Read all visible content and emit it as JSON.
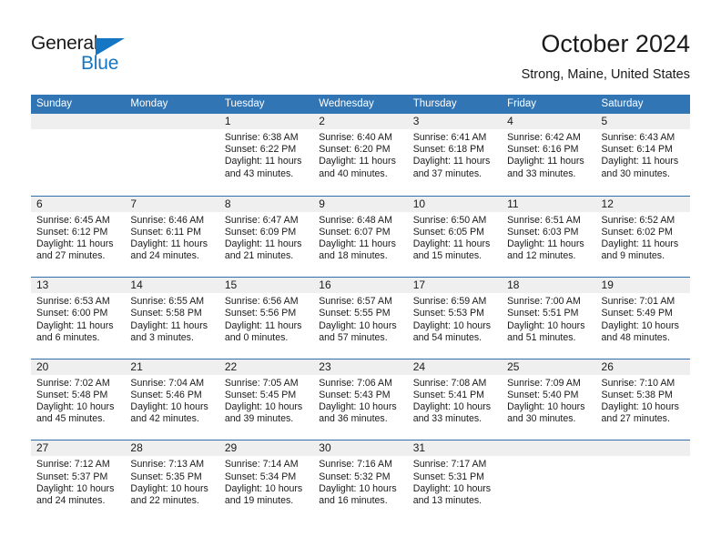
{
  "brand": {
    "name_part1": "General",
    "name_part2": "Blue"
  },
  "header": {
    "title": "October 2024",
    "subtitle": "Strong, Maine, United States"
  },
  "colors": {
    "header_blue": "#3175b5",
    "separator_blue": "#2f6fae",
    "daynum_band": "#efefef",
    "brand_blue": "#1577c4"
  },
  "weekdays": [
    "Sunday",
    "Monday",
    "Tuesday",
    "Wednesday",
    "Thursday",
    "Friday",
    "Saturday"
  ],
  "weeks": [
    [
      {
        "day": "",
        "sunrise": "",
        "sunset": "",
        "daylight": "",
        "empty": true
      },
      {
        "day": "",
        "sunrise": "",
        "sunset": "",
        "daylight": "",
        "empty": true
      },
      {
        "day": "1",
        "sunrise": "Sunrise: 6:38 AM",
        "sunset": "Sunset: 6:22 PM",
        "daylight": "Daylight: 11 hours and 43 minutes."
      },
      {
        "day": "2",
        "sunrise": "Sunrise: 6:40 AM",
        "sunset": "Sunset: 6:20 PM",
        "daylight": "Daylight: 11 hours and 40 minutes."
      },
      {
        "day": "3",
        "sunrise": "Sunrise: 6:41 AM",
        "sunset": "Sunset: 6:18 PM",
        "daylight": "Daylight: 11 hours and 37 minutes."
      },
      {
        "day": "4",
        "sunrise": "Sunrise: 6:42 AM",
        "sunset": "Sunset: 6:16 PM",
        "daylight": "Daylight: 11 hours and 33 minutes."
      },
      {
        "day": "5",
        "sunrise": "Sunrise: 6:43 AM",
        "sunset": "Sunset: 6:14 PM",
        "daylight": "Daylight: 11 hours and 30 minutes."
      }
    ],
    [
      {
        "day": "6",
        "sunrise": "Sunrise: 6:45 AM",
        "sunset": "Sunset: 6:12 PM",
        "daylight": "Daylight: 11 hours and 27 minutes."
      },
      {
        "day": "7",
        "sunrise": "Sunrise: 6:46 AM",
        "sunset": "Sunset: 6:11 PM",
        "daylight": "Daylight: 11 hours and 24 minutes."
      },
      {
        "day": "8",
        "sunrise": "Sunrise: 6:47 AM",
        "sunset": "Sunset: 6:09 PM",
        "daylight": "Daylight: 11 hours and 21 minutes."
      },
      {
        "day": "9",
        "sunrise": "Sunrise: 6:48 AM",
        "sunset": "Sunset: 6:07 PM",
        "daylight": "Daylight: 11 hours and 18 minutes."
      },
      {
        "day": "10",
        "sunrise": "Sunrise: 6:50 AM",
        "sunset": "Sunset: 6:05 PM",
        "daylight": "Daylight: 11 hours and 15 minutes."
      },
      {
        "day": "11",
        "sunrise": "Sunrise: 6:51 AM",
        "sunset": "Sunset: 6:03 PM",
        "daylight": "Daylight: 11 hours and 12 minutes."
      },
      {
        "day": "12",
        "sunrise": "Sunrise: 6:52 AM",
        "sunset": "Sunset: 6:02 PM",
        "daylight": "Daylight: 11 hours and 9 minutes."
      }
    ],
    [
      {
        "day": "13",
        "sunrise": "Sunrise: 6:53 AM",
        "sunset": "Sunset: 6:00 PM",
        "daylight": "Daylight: 11 hours and 6 minutes."
      },
      {
        "day": "14",
        "sunrise": "Sunrise: 6:55 AM",
        "sunset": "Sunset: 5:58 PM",
        "daylight": "Daylight: 11 hours and 3 minutes."
      },
      {
        "day": "15",
        "sunrise": "Sunrise: 6:56 AM",
        "sunset": "Sunset: 5:56 PM",
        "daylight": "Daylight: 11 hours and 0 minutes."
      },
      {
        "day": "16",
        "sunrise": "Sunrise: 6:57 AM",
        "sunset": "Sunset: 5:55 PM",
        "daylight": "Daylight: 10 hours and 57 minutes."
      },
      {
        "day": "17",
        "sunrise": "Sunrise: 6:59 AM",
        "sunset": "Sunset: 5:53 PM",
        "daylight": "Daylight: 10 hours and 54 minutes."
      },
      {
        "day": "18",
        "sunrise": "Sunrise: 7:00 AM",
        "sunset": "Sunset: 5:51 PM",
        "daylight": "Daylight: 10 hours and 51 minutes."
      },
      {
        "day": "19",
        "sunrise": "Sunrise: 7:01 AM",
        "sunset": "Sunset: 5:49 PM",
        "daylight": "Daylight: 10 hours and 48 minutes."
      }
    ],
    [
      {
        "day": "20",
        "sunrise": "Sunrise: 7:02 AM",
        "sunset": "Sunset: 5:48 PM",
        "daylight": "Daylight: 10 hours and 45 minutes."
      },
      {
        "day": "21",
        "sunrise": "Sunrise: 7:04 AM",
        "sunset": "Sunset: 5:46 PM",
        "daylight": "Daylight: 10 hours and 42 minutes."
      },
      {
        "day": "22",
        "sunrise": "Sunrise: 7:05 AM",
        "sunset": "Sunset: 5:45 PM",
        "daylight": "Daylight: 10 hours and 39 minutes."
      },
      {
        "day": "23",
        "sunrise": "Sunrise: 7:06 AM",
        "sunset": "Sunset: 5:43 PM",
        "daylight": "Daylight: 10 hours and 36 minutes."
      },
      {
        "day": "24",
        "sunrise": "Sunrise: 7:08 AM",
        "sunset": "Sunset: 5:41 PM",
        "daylight": "Daylight: 10 hours and 33 minutes."
      },
      {
        "day": "25",
        "sunrise": "Sunrise: 7:09 AM",
        "sunset": "Sunset: 5:40 PM",
        "daylight": "Daylight: 10 hours and 30 minutes."
      },
      {
        "day": "26",
        "sunrise": "Sunrise: 7:10 AM",
        "sunset": "Sunset: 5:38 PM",
        "daylight": "Daylight: 10 hours and 27 minutes."
      }
    ],
    [
      {
        "day": "27",
        "sunrise": "Sunrise: 7:12 AM",
        "sunset": "Sunset: 5:37 PM",
        "daylight": "Daylight: 10 hours and 24 minutes."
      },
      {
        "day": "28",
        "sunrise": "Sunrise: 7:13 AM",
        "sunset": "Sunset: 5:35 PM",
        "daylight": "Daylight: 10 hours and 22 minutes."
      },
      {
        "day": "29",
        "sunrise": "Sunrise: 7:14 AM",
        "sunset": "Sunset: 5:34 PM",
        "daylight": "Daylight: 10 hours and 19 minutes."
      },
      {
        "day": "30",
        "sunrise": "Sunrise: 7:16 AM",
        "sunset": "Sunset: 5:32 PM",
        "daylight": "Daylight: 10 hours and 16 minutes."
      },
      {
        "day": "31",
        "sunrise": "Sunrise: 7:17 AM",
        "sunset": "Sunset: 5:31 PM",
        "daylight": "Daylight: 10 hours and 13 minutes."
      },
      {
        "day": "",
        "sunrise": "",
        "sunset": "",
        "daylight": "",
        "empty": true
      },
      {
        "day": "",
        "sunrise": "",
        "sunset": "",
        "daylight": "",
        "empty": true
      }
    ]
  ]
}
